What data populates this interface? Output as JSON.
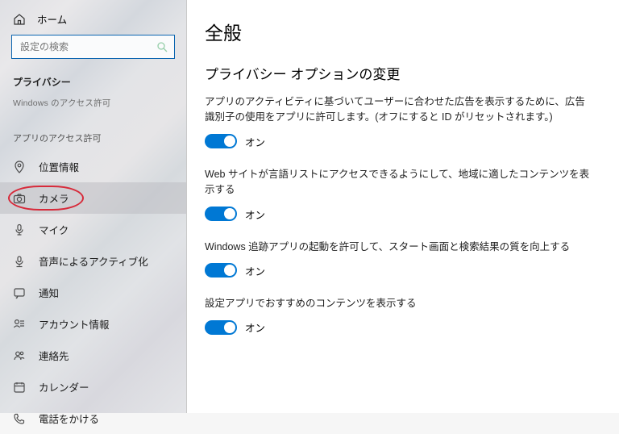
{
  "sidebar": {
    "home": "ホーム",
    "search_placeholder": "設定の検索",
    "category": "プライバシー",
    "muted": "Windows のアクセス許可",
    "subhead": "アプリのアクセス許可",
    "items": [
      {
        "label": "位置情報"
      },
      {
        "label": "カメラ"
      },
      {
        "label": "マイク"
      },
      {
        "label": "音声によるアクティブ化"
      },
      {
        "label": "通知"
      },
      {
        "label": "アカウント情報"
      },
      {
        "label": "連絡先"
      },
      {
        "label": "カレンダー"
      },
      {
        "label": "電話をかける"
      }
    ]
  },
  "main": {
    "title": "全般",
    "section": "プライバシー オプションの変更",
    "settings": [
      {
        "desc": "アプリのアクティビティに基づいてユーザーに合わせた広告を表示するために、広告識別子の使用をアプリに許可します。(オフにすると ID がリセットされます。)",
        "state": "オン"
      },
      {
        "desc": "Web サイトが言語リストにアクセスできるようにして、地域に適したコンテンツを表示する",
        "state": "オン"
      },
      {
        "desc": "Windows 追跡アプリの起動を許可して、スタート画面と検索結果の質を向上する",
        "state": "オン"
      },
      {
        "desc": "設定アプリでおすすめのコンテンツを表示する",
        "state": "オン"
      }
    ]
  }
}
